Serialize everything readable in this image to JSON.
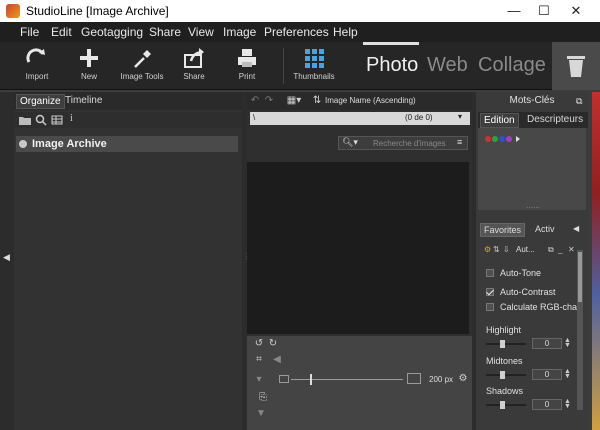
{
  "window": {
    "title": "StudioLine [Image Archive]",
    "minimize": "—",
    "maximize": "☐",
    "close": "✕"
  },
  "menu": [
    "File",
    "Edit",
    "Geotagging",
    "Share",
    "View",
    "Image",
    "Preferences",
    "Help"
  ],
  "toolbar": {
    "tools": [
      {
        "label": "Import",
        "icon": "import-icon"
      },
      {
        "label": "New",
        "icon": "plus-icon"
      },
      {
        "label": "Image Tools",
        "icon": "eyedropper-icon"
      },
      {
        "label": "Share",
        "icon": "share-icon"
      },
      {
        "label": "Print",
        "icon": "printer-icon"
      },
      {
        "label": "Thumbnails",
        "icon": "grid-icon"
      }
    ],
    "modes": [
      "Photo",
      "Web",
      "Collage"
    ],
    "active_mode": "Photo"
  },
  "left_panel": {
    "tabs": [
      "Organize",
      "Timeline"
    ],
    "active_tab": "Organize",
    "archive_label": "Image Archive"
  },
  "center_panel": {
    "sort_label": "Image Name (Ascending)",
    "path": "\\",
    "count": "(0 de 0)",
    "search_placeholder": "Recherche d'images",
    "thumb_size": "200 px"
  },
  "right_panel": {
    "title": "Mots-Clés",
    "tabs": [
      "Edition",
      "Descripteurs"
    ],
    "active_tab": "Edition",
    "bottom_tabs": [
      "Favorites",
      "Activ"
    ],
    "active_bottom_tab": "Favorites",
    "preset_label": "Aut...",
    "options": [
      {
        "label": "Auto-Tone",
        "checked": false
      },
      {
        "label": "Auto-Contrast",
        "checked": true
      },
      {
        "label": "Calculate RGB-char",
        "checked": false
      }
    ],
    "sliders": [
      {
        "label": "Highlight",
        "value": "0"
      },
      {
        "label": "Midtones",
        "value": "0"
      },
      {
        "label": "Shadows",
        "value": "0"
      }
    ]
  },
  "colors": {
    "accent": "#4aa3df",
    "background": "#3c3c3c",
    "toolbar": "#262626"
  }
}
